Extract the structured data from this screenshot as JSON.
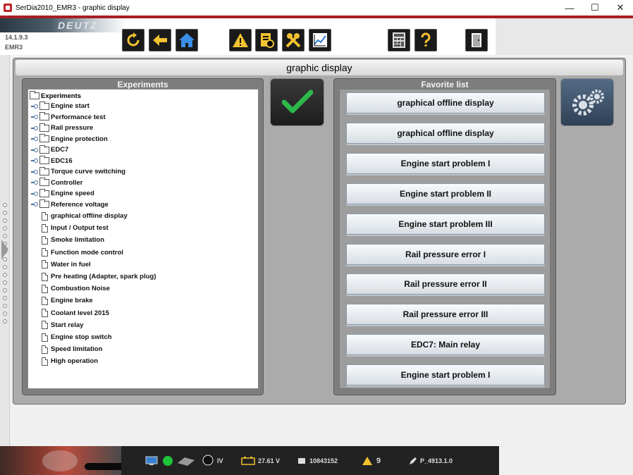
{
  "window": {
    "title": "SerDia2010_EMR3 - graphic display",
    "minimize": "—",
    "maximize": "☐",
    "close": "✕"
  },
  "toolbar": {
    "logo_text": "DEUTZ",
    "version": "14.1.9.3",
    "variant": "EMR3",
    "buttons": [
      {
        "name": "refresh",
        "icon": "refresh-icon"
      },
      {
        "name": "back",
        "icon": "arrow-left-icon"
      },
      {
        "name": "home",
        "icon": "home-icon"
      },
      {
        "name": "warning",
        "icon": "warning-icon"
      },
      {
        "name": "parameters",
        "icon": "document-gear-icon"
      },
      {
        "name": "tools",
        "icon": "tools-icon"
      },
      {
        "name": "chart",
        "icon": "chart-icon"
      },
      {
        "name": "calculator",
        "icon": "calculator-icon"
      },
      {
        "name": "help",
        "icon": "help-icon"
      },
      {
        "name": "exit",
        "icon": "exit-door-icon"
      }
    ]
  },
  "main": {
    "title": "graphic display",
    "experiments": {
      "title": "Experiments",
      "root": "Experiments",
      "folders": [
        "Engine start",
        "Performance test",
        "Rail pressure",
        "Engine protection",
        "EDC7",
        "EDC16",
        "Torque curve switching",
        "Controller",
        "Engine speed",
        "Reference voltage"
      ],
      "documents": [
        "graphical offline display",
        "Input / Output test",
        "Smoke limitation",
        "Function mode control",
        "Water in fuel",
        "Pre heating (Adapter, spark plug)",
        "Combustion Noise",
        "Engine brake",
        "Coolant level 2015",
        "Start relay",
        "Engine stop switch",
        "Speed limitation",
        "High operation"
      ]
    },
    "favorites": {
      "title": "Favorite list",
      "items": [
        "graphical offline display",
        "graphical offline display",
        "Engine start problem I",
        "Engine start problem II",
        "Engine start problem III",
        "Rail pressure error I",
        "Rail pressure error II",
        "Rail pressure error III",
        "EDC7: Main relay",
        "Engine start problem I"
      ]
    },
    "colors": {
      "panel": "#ababab",
      "group": "#7d7d7d",
      "check": "#2db84a"
    }
  },
  "status": {
    "interface": "IV",
    "voltage": "27.61 V",
    "serial": "10843152",
    "warnings": "9",
    "param": "P_4913.1.0"
  }
}
